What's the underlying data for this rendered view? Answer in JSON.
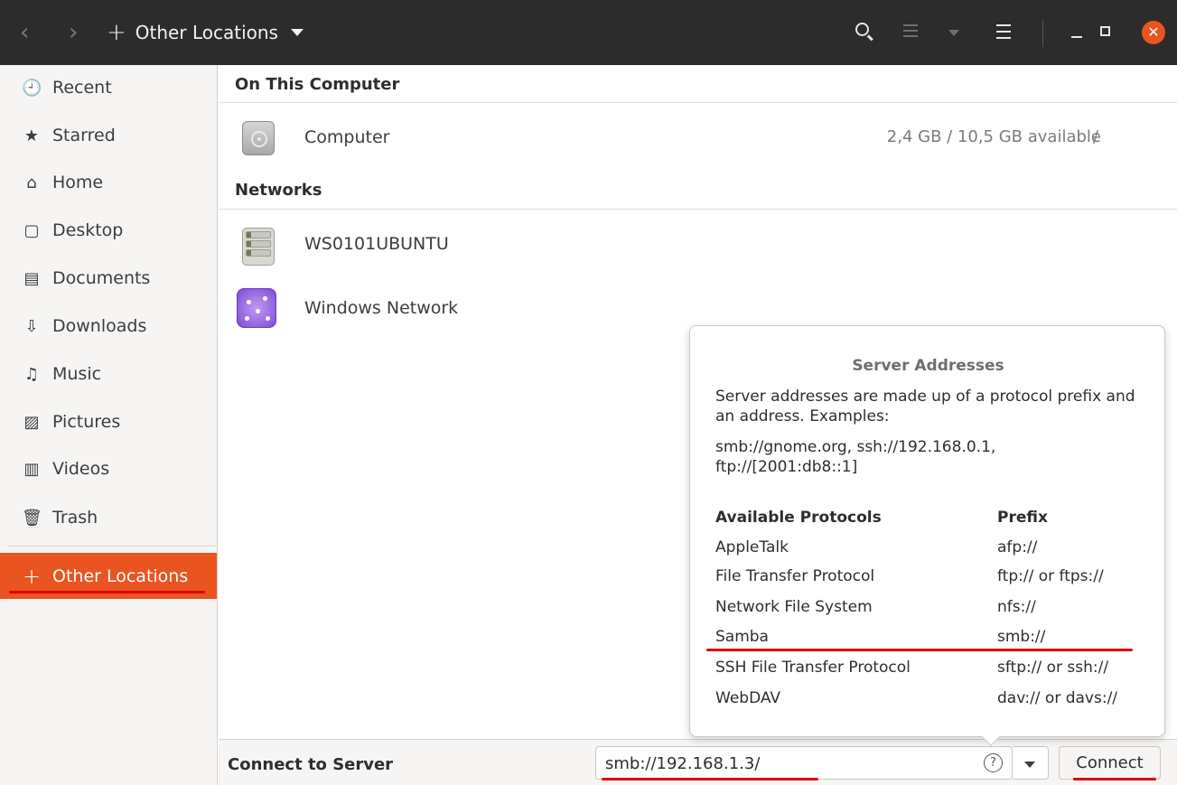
{
  "header": {
    "back_icon": "‹",
    "forward_icon": "›",
    "location_label": "Other Locations",
    "location_icon": "+"
  },
  "sidebar": {
    "items": [
      {
        "label": "Recent",
        "icon": "🕘"
      },
      {
        "label": "Starred",
        "icon": "★"
      },
      {
        "label": "Home",
        "icon": "⌂"
      },
      {
        "label": "Desktop",
        "icon": "▢"
      },
      {
        "label": "Documents",
        "icon": "▤"
      },
      {
        "label": "Downloads",
        "icon": "⇩"
      },
      {
        "label": "Music",
        "icon": "♫"
      },
      {
        "label": "Pictures",
        "icon": "▨"
      },
      {
        "label": "Videos",
        "icon": "▥"
      },
      {
        "label": "Trash",
        "icon": "🗑"
      }
    ],
    "active": {
      "label": "Other Locations",
      "icon": "+"
    }
  },
  "main": {
    "on_this_computer": "On This Computer",
    "computer": {
      "label": "Computer",
      "info": "2,4 GB / 10,5 GB available",
      "mount": "/"
    },
    "networks": "Networks",
    "network_items": [
      {
        "label": "WS0101UBUNTU"
      },
      {
        "label": "Windows Network"
      }
    ]
  },
  "bottombar": {
    "label": "Connect to Server",
    "address_value": "smb://192.168.1.3/",
    "help_icon": "?",
    "connect_label": "Connect"
  },
  "popover": {
    "title": "Server Addresses",
    "description": "Server addresses are made up of a protocol prefix and an address. Examples:",
    "examples": "smb://gnome.org, ssh://192.168.0.1, ftp://[2001:db8::1]",
    "col_protocols": "Available Protocols",
    "col_prefix": "Prefix",
    "protocols": [
      {
        "name": "AppleTalk",
        "prefix": "afp://"
      },
      {
        "name": "File Transfer Protocol",
        "prefix": "ftp:// or ftps://"
      },
      {
        "name": "Network File System",
        "prefix": "nfs://"
      },
      {
        "name": "Samba",
        "prefix": "smb://"
      },
      {
        "name": "SSH File Transfer Protocol",
        "prefix": "sftp:// or ssh://"
      },
      {
        "name": "WebDAV",
        "prefix": "dav:// or davs://"
      }
    ]
  },
  "colors": {
    "accent": "#e95420",
    "headerbar": "#2c2c2c",
    "annotation": "#e00000"
  }
}
